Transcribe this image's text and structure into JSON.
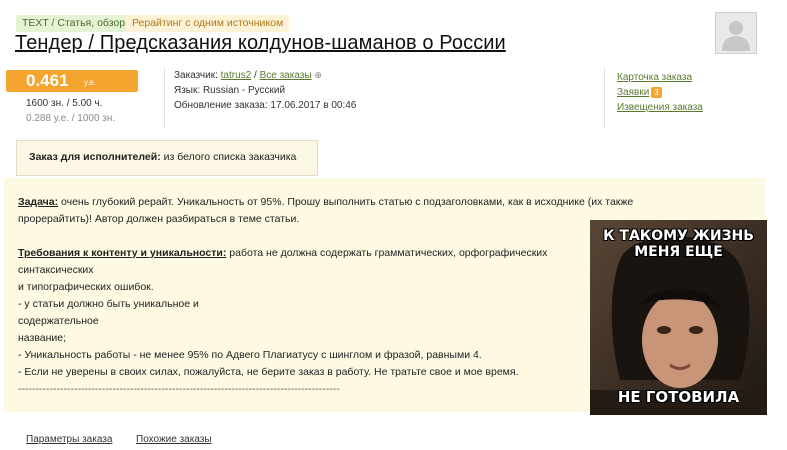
{
  "tags": {
    "category": "TEXT / Статья, обзор",
    "type": "Рерайтинг с одним источником"
  },
  "title": "Тендер / Предсказания колдунов-шаманов о России",
  "price": {
    "amount": "0.461",
    "unit": "у.е.",
    "volume": "1600 зн. / 5.00 ч.",
    "rate": "0.288 у.е. / 1000 зн."
  },
  "info": {
    "customer_label": "Заказчик:",
    "customer_name": "tatrus2",
    "separator": "/",
    "all_orders": "Все заказы",
    "language_label": "Язык:",
    "language_value": "Russian - Русский",
    "updated_label": "Обновление заказа:",
    "updated_value": "17.06.2017 в 00:46"
  },
  "side_links": {
    "order_card": "Карточка заказа",
    "applications": "Заявки",
    "applications_count": "3",
    "notifications": "Извещения заказа"
  },
  "executor": {
    "label": "Заказ для исполнителей:",
    "value": "из белого списка заказчика"
  },
  "description": {
    "task_label": "Задача:",
    "task_line1": "очень глубокий рерайт. Уникальность от 95%. Прошу выполнить статью с подзаголовками, как в исходнике (их также",
    "task_line2": "прорерайтить)! Автор должен разбираться в теме статьи.",
    "req_label": "Требования к контенту и уникальности:",
    "req_line1": "работа не должна содержать грамматических, орфографических",
    "lines": [
      "синтаксических",
      "и типографических ошибок.",
      "- у статьи должно быть уникальное и",
      "содержательное",
      "название;",
      "- Уникальность работы - не менее 95% по Адвего Плагиатусу с шинглом и фразой, равными 4.",
      "- Если не уверены в своих силах, пожалуйста, не берите заказ в работу. Не тратьте свое и мое время."
    ],
    "divider": "--------------------------------------------------------------------------------------------"
  },
  "meme": {
    "top": "К ТАКОМУ ЖИЗНЬ МЕНЯ ЕЩЕ",
    "bottom": "НЕ ГОТОВИЛА"
  },
  "bottom_links": {
    "params": "Параметры заказа",
    "similar": "Похожие заказы"
  },
  "colors": {
    "accent": "#f5a52e",
    "link": "#5a7a2e",
    "desc_bg": "#fdf9e3"
  }
}
